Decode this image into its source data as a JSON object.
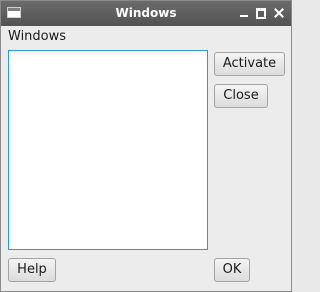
{
  "window": {
    "title": "Windows",
    "controls": {
      "minimize_icon": "minimize-icon",
      "maximize_icon": "maximize-icon",
      "close_icon": "close-icon"
    }
  },
  "main": {
    "label": "Windows",
    "list_items": []
  },
  "buttons": {
    "activate": "Activate",
    "close": "Close",
    "help": "Help",
    "ok": "OK"
  },
  "colors": {
    "titlebar": "#5f5f5f",
    "list_focus_border": "#2e9ad8",
    "background": "#ececec"
  }
}
